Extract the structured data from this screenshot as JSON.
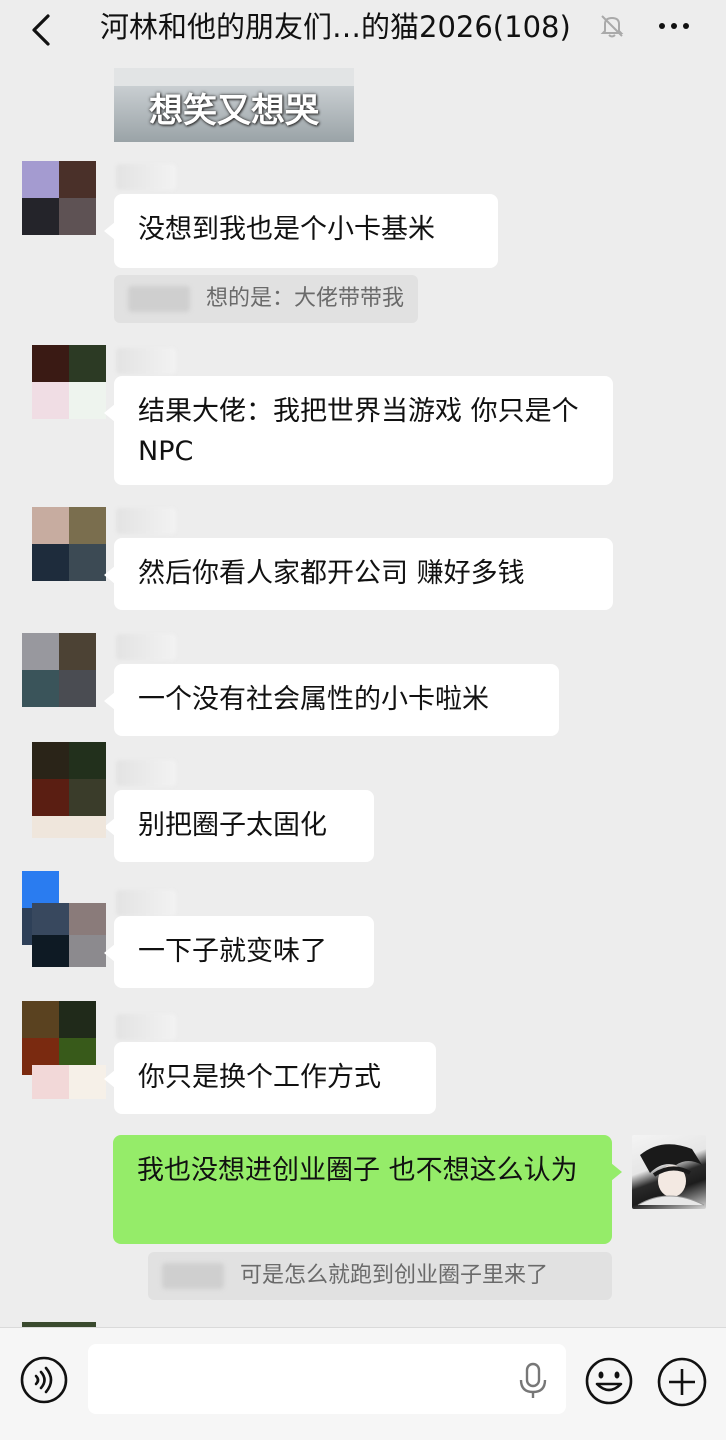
{
  "header": {
    "title": "河林和他的朋友们…的猫2026(108)",
    "back_icon": "chevron-left-icon",
    "mute_icon": "bell-off-icon",
    "more_icon": "more-dots-icon"
  },
  "sticker": {
    "text": "想笑又想哭"
  },
  "messages": [
    {
      "text": "没想到我也是个小卡基米"
    },
    {
      "text": "结果大佬：我把世界当游戏 你只是个NPC"
    },
    {
      "text": "然后你看人家都开公司 赚好多钱"
    },
    {
      "text": "一个没有社会属性的小卡啦米"
    },
    {
      "text": "别把圈子太固化"
    },
    {
      "text": "一下子就变味了"
    },
    {
      "text": "你只是换个工作方式"
    },
    {
      "text": "我也没想进创业圈子   也不想这么认为"
    }
  ],
  "quotes": [
    {
      "text": "想的是：大佬带带我"
    },
    {
      "text": "可是怎么就跑到创业圈子里来了"
    }
  ],
  "input": {
    "value": "",
    "placeholder": ""
  },
  "colors": {
    "bubble_self": "#95ec69",
    "bubble_other": "#ffffff",
    "background": "#ededed"
  },
  "icons": [
    "voice-icon",
    "microphone-icon",
    "emoji-icon",
    "plus-icon"
  ]
}
